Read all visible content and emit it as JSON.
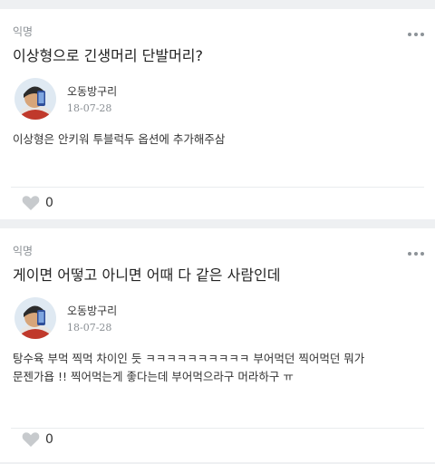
{
  "posts": [
    {
      "board": "익명",
      "title": "이상형으로 긴생머리 단발머리?",
      "author": {
        "nickname": "오동방구리",
        "date": "18-07-28"
      },
      "body": [
        "이상형은 안키워 투블럭두 옵션에 추가해주삼"
      ],
      "likes": "0",
      "icons": {
        "menu": "more-dots-icon",
        "like": "heart-icon"
      }
    },
    {
      "board": "익명",
      "title": "게이면 어떻고 아니면 어때 다 같은 사람인데",
      "author": {
        "nickname": "오동방구리",
        "date": "18-07-28"
      },
      "body": [
        "탕수육 부먹 찍먹 차이인 듯 ㅋㅋㅋㅋㅋㅋㅋㅋㅋㅋ 부어먹던 찍어먹던 뭐가",
        "문젠가욥 !! 찍어먹는게 좋다는데 부어먹으라구 머라하구 ㅠ"
      ],
      "likes": "0",
      "icons": {
        "menu": "more-dots-icon",
        "like": "heart-icon"
      }
    }
  ],
  "colors": {
    "background": "#eef0f2",
    "card": "#ffffff",
    "muted": "#8a8f94",
    "heart": "#c7cacd"
  }
}
